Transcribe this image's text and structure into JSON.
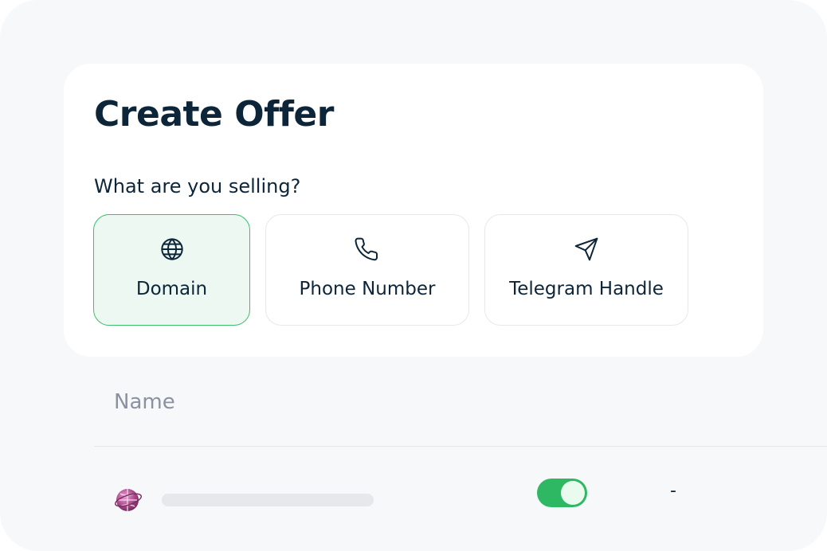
{
  "offer": {
    "title": "Create Offer",
    "question": "What are you selling?",
    "options": [
      {
        "label": "Domain",
        "icon": "globe-icon",
        "selected": true
      },
      {
        "label": "Phone Number",
        "icon": "phone-icon",
        "selected": false
      },
      {
        "label": "Telegram Handle",
        "icon": "send-icon",
        "selected": false
      }
    ]
  },
  "table": {
    "name_header": "Name",
    "rows": [
      {
        "avatar": "globe-avatar-icon",
        "toggle_on": true,
        "value": "-"
      }
    ]
  },
  "colors": {
    "accent": "#2eb864",
    "selected_bg": "#ecf8f1",
    "text_primary": "#0c2538",
    "text_muted": "#8a92a0"
  }
}
